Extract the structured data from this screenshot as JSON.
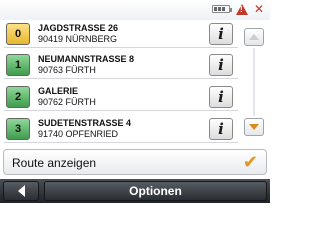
{
  "status": {
    "icons": [
      "battery-icon",
      "warning-icon",
      "no-signal-icon"
    ],
    "warning_symbol": "!",
    "signal_symbol": "✕"
  },
  "destinations": [
    {
      "number": "0",
      "color": "yellow",
      "street": "JAGDSTRASSE 26",
      "city": "90419 NÜRNBERG",
      "info": "i"
    },
    {
      "number": "1",
      "color": "green",
      "street": "NEUMANNSTRASSE 8",
      "city": "90763 FÜRTH",
      "info": "i"
    },
    {
      "number": "2",
      "color": "green",
      "street": "GALERIE",
      "city": "90762 FÜRTH",
      "info": "i"
    },
    {
      "number": "3",
      "color": "green",
      "street": "SUDETENSTRASSE 4",
      "city": "91740 OPFENRIED",
      "info": "i"
    }
  ],
  "route_button": {
    "label": "Route anzeigen",
    "check": "✔"
  },
  "bottom": {
    "options_label": "Optionen"
  },
  "colors": {
    "yellow_badge": "#e8b62b",
    "green_badge": "#3f9c4b",
    "check": "#e2961e",
    "bottom_bar": "#2a2d31"
  }
}
